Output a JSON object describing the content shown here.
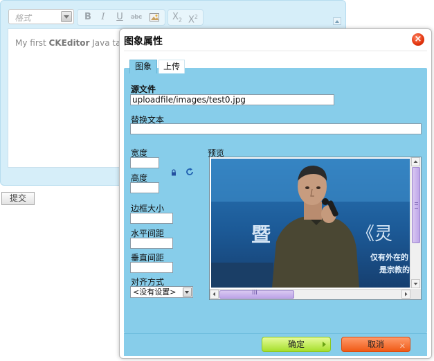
{
  "editor": {
    "format_label": "格式",
    "toolbar_buttons": [
      "B",
      "I",
      "U",
      "abc"
    ],
    "content_plain": "My first ",
    "content_bold": "CKEditor",
    "content_rest": " Java tag"
  },
  "submit_label": "提交",
  "dialog": {
    "title": "图象属性",
    "tabs": [
      {
        "label": "图象",
        "active": true
      },
      {
        "label": "上传",
        "active": false
      }
    ],
    "source_label": "源文件",
    "source_value": "uploadfile/images/test0.jpg",
    "alt_label": "替换文本",
    "alt_value": "",
    "width_label": "宽度",
    "width_value": "",
    "height_label": "高度",
    "height_value": "",
    "border_label": "边框大小",
    "border_value": "",
    "hspace_label": "水平间距",
    "hspace_value": "",
    "vspace_label": "垂直间距",
    "vspace_value": "",
    "align_label": "对齐方式",
    "align_value": "<没有设置>",
    "preview_label": "预览",
    "preview_banner_text": "暨",
    "preview_quote_text": "《灵",
    "preview_line1": "仅有外在的",
    "preview_line2": "是宗教的",
    "scroll_h_grip": "III",
    "ok_label": "确定",
    "cancel_label": "取消"
  },
  "colors": {
    "dialog_panel": "#87cdea",
    "ok_button": "#a6df2c",
    "cancel_button": "#f05a16",
    "close_button": "#e2330c"
  }
}
